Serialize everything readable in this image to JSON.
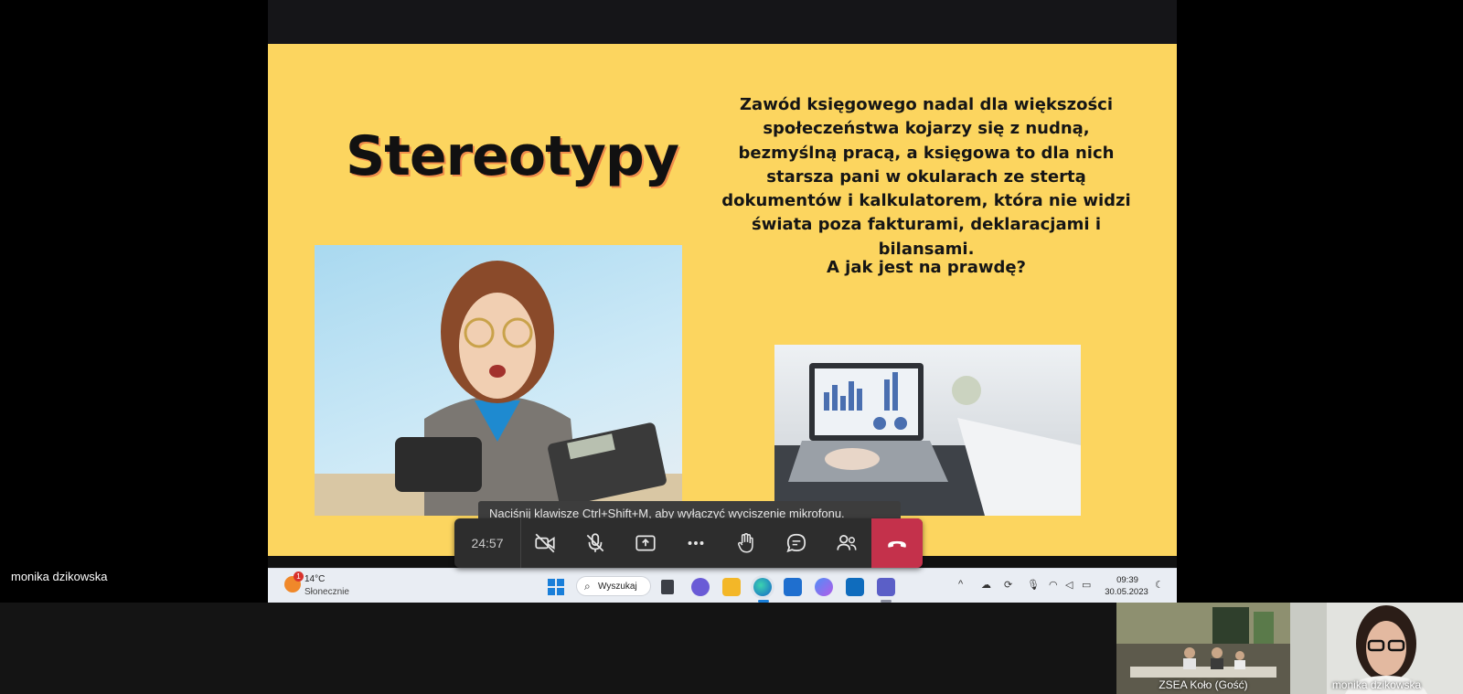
{
  "slide": {
    "title": "Stereotypy",
    "body": "Zawód księgowego nadal dla większości społeczeństwa kojarzy się z nudną, bezmyślną pracą, a księgowa to dla nich starsza pani w okularach ze stertą dokumentów i kalkulatorem, która nie widzi świata poza fakturami, deklaracjami i bilansami.",
    "question": "A jak jest na prawdę?",
    "background_color": "#fcd55f"
  },
  "taskbar": {
    "weather_temp": "14°C",
    "weather_condition": "Słonecznie",
    "weather_badge": "1",
    "search_label": "Wyszukaj",
    "time": "09:39",
    "date": "30.05.2023",
    "apps": [
      "start-icon",
      "task-view-icon",
      "teams-chat-icon",
      "file-explorer-icon",
      "edge-icon",
      "store-icon",
      "copilot-icon",
      "outlook-icon",
      "teams-icon"
    ]
  },
  "meeting": {
    "toast": "Naciśnij klawisze Ctrl+Shift+M, aby wyłączyć wyciszenie mikrofonu.",
    "timer": "24:57",
    "controls": [
      "camera-off-icon",
      "mic-off-icon",
      "share-screen-icon",
      "more-icon",
      "raise-hand-icon",
      "chat-icon",
      "people-icon",
      "hang-up-icon"
    ],
    "hangup_color": "#c4314b",
    "presenter_name": "monika dzikowska",
    "participants": [
      {
        "name": "ZSEA Koło (Gość)"
      },
      {
        "name": "monika dzikowska"
      }
    ]
  }
}
